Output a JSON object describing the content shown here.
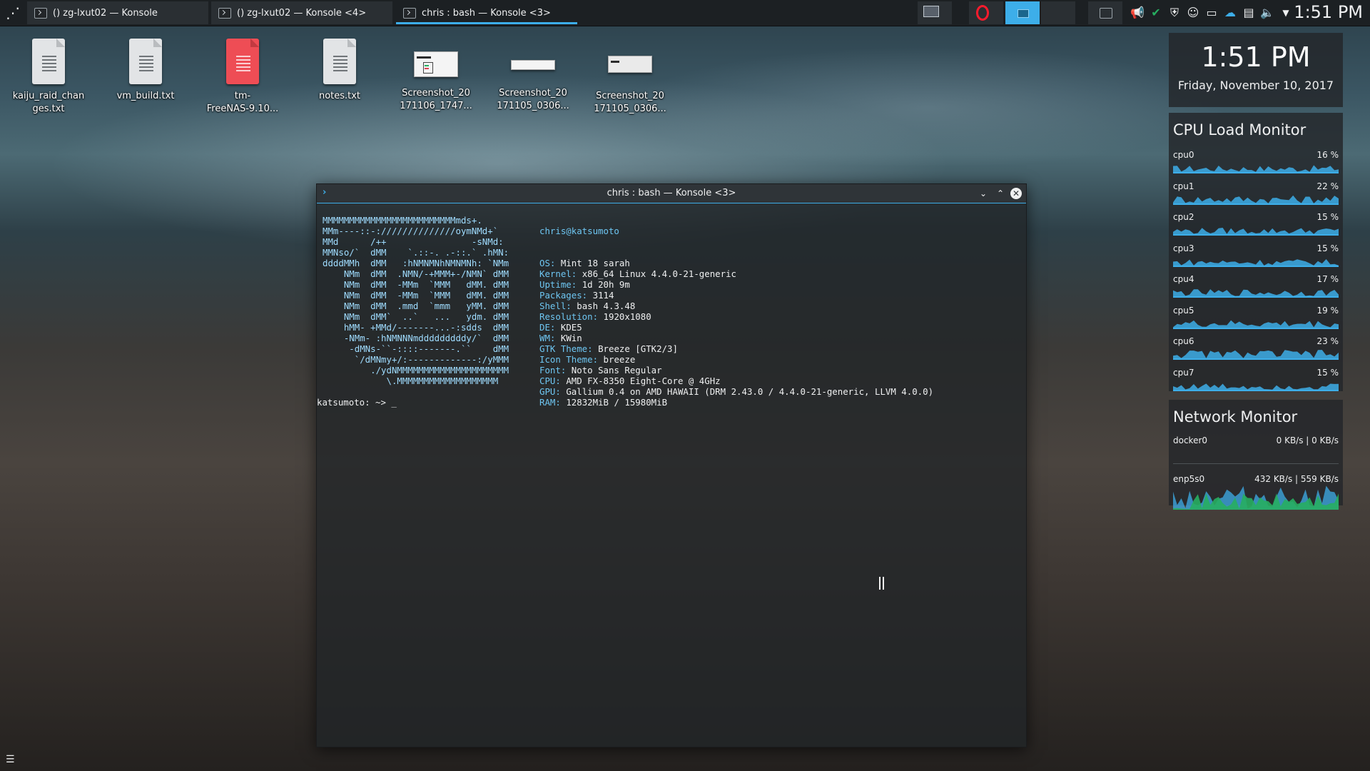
{
  "taskbar": {
    "tasks": [
      {
        "label": "() zg-lxut02 — Konsole"
      },
      {
        "label": "() zg-lxut02 — Konsole <4>"
      },
      {
        "label": "chris : bash — Konsole <3>"
      }
    ],
    "clock": "1:51 PM",
    "tray_icons": [
      "notification-icon",
      "check-icon",
      "shield-icon",
      "user-icon",
      "monitor-icon",
      "cloud-icon",
      "clipboard-icon",
      "volume-icon",
      "expand-arrow-icon"
    ]
  },
  "desktop_icons": [
    {
      "label": "kaiju_raid_changes.txt",
      "line1": "kaiju_raid_chan",
      "line2": "ges.txt",
      "type": "text"
    },
    {
      "label": "vm_build.txt",
      "line1": "vm_build.txt",
      "line2": "",
      "type": "text"
    },
    {
      "label": "tm-FreeNAS-9.10...",
      "line1": "tm-",
      "line2": "FreeNAS-9.10...",
      "type": "red"
    },
    {
      "label": "notes.txt",
      "line1": "notes.txt",
      "line2": "",
      "type": "text"
    },
    {
      "label": "Screenshot_20171106_1747...",
      "line1": "Screenshot_20",
      "line2": "171106_1747...",
      "type": "image"
    },
    {
      "label": "Screenshot_20171105_0306...",
      "line1": "Screenshot_20",
      "line2": "171105_0306...",
      "type": "image"
    },
    {
      "label": "Screenshot_20171105_0306...",
      "line1": "Screenshot_20",
      "line2": "171105_0306...",
      "type": "image"
    }
  ],
  "window": {
    "title": "chris : bash — Konsole <3>",
    "neofetch": {
      "header": "chris@katsumoto",
      "fields": [
        {
          "key": "OS:",
          "value": "Mint 18 sarah"
        },
        {
          "key": "Kernel:",
          "value": "x86_64 Linux 4.4.0-21-generic"
        },
        {
          "key": "Uptime:",
          "value": "1d 20h 9m"
        },
        {
          "key": "Packages:",
          "value": "3114"
        },
        {
          "key": "Shell:",
          "value": "bash 4.3.48"
        },
        {
          "key": "Resolution:",
          "value": "1920x1080"
        },
        {
          "key": "DE:",
          "value": "KDE5"
        },
        {
          "key": "WM:",
          "value": "KWin"
        },
        {
          "key": "GTK Theme:",
          "value": "Breeze [GTK2/3]"
        },
        {
          "key": "Icon Theme:",
          "value": "breeze"
        },
        {
          "key": "Font:",
          "value": "Noto Sans Regular"
        },
        {
          "key": "CPU:",
          "value": "AMD FX-8350 Eight-Core @ 4GHz"
        },
        {
          "key": "GPU:",
          "value": "Gallium 0.4 on AMD HAWAII (DRM 2.43.0 / 4.4.0-21-generic, LLVM 4.0.0)"
        },
        {
          "key": "RAM:",
          "value": "12832MiB / 15980MiB"
        }
      ],
      "ascii": [
        "MMMMMMMMMMMMMMMMMMMMMMMMMmds+.",
        "MMm----::-://////////////oymNMd+`",
        "MMd      /++                -sNMd:",
        "MMNso/`  dMM    `.::-. .-::.` .hMN:",
        "ddddMMh  dMM   :hNMNMNhNMNMNh: `NMm",
        "    NMm  dMM  .NMN/-+MMM+-/NMN` dMM",
        "    NMm  dMM  -MMm  `MMM   dMM. dMM",
        "    NMm  dMM  -MMm  `MMM   dMM. dMM",
        "    NMm  dMM  .mmd  `mmm   yMM. dMM",
        "    NMm  dMM`  ..`   ...   ydm. dMM",
        "    hMM- +MMd/-------...-:sdds  dMM",
        "    -NMm- :hNMNNNmdddddddddy/`  dMM",
        "     -dMNs-``-::::-------.``    dMM",
        "      `/dMNmy+/:-------------:/yMMM",
        "         ./ydNMMMMMMMMMMMMMMMMMMMMM",
        "            \\.MMMMMMMMMMMMMMMMMMM"
      ]
    },
    "prompt": "katsumoto: ~> _"
  },
  "clock_widget": {
    "time": "1:51 PM",
    "date": "Friday, November 10, 2017"
  },
  "cpu_monitor": {
    "title": "CPU Load Monitor",
    "cpus": [
      {
        "name": "cpu0",
        "value": "16 %",
        "load": 16
      },
      {
        "name": "cpu1",
        "value": "22 %",
        "load": 22
      },
      {
        "name": "cpu2",
        "value": "15 %",
        "load": 15
      },
      {
        "name": "cpu3",
        "value": "15 %",
        "load": 15
      },
      {
        "name": "cpu4",
        "value": "17 %",
        "load": 17
      },
      {
        "name": "cpu5",
        "value": "19 %",
        "load": 19
      },
      {
        "name": "cpu6",
        "value": "23 %",
        "load": 23
      },
      {
        "name": "cpu7",
        "value": "15 %",
        "load": 15
      }
    ]
  },
  "network_monitor": {
    "title": "Network Monitor",
    "interfaces": [
      {
        "name": "docker0",
        "value": "0 KB/s | 0 KB/s"
      },
      {
        "name": "enp5s0",
        "value": "432 KB/s | 559 KB/s"
      }
    ]
  },
  "colors": {
    "accent": "#3daee9",
    "panel": "#1c2023",
    "graph": "#3daee9",
    "graph_green": "#27ae60"
  }
}
